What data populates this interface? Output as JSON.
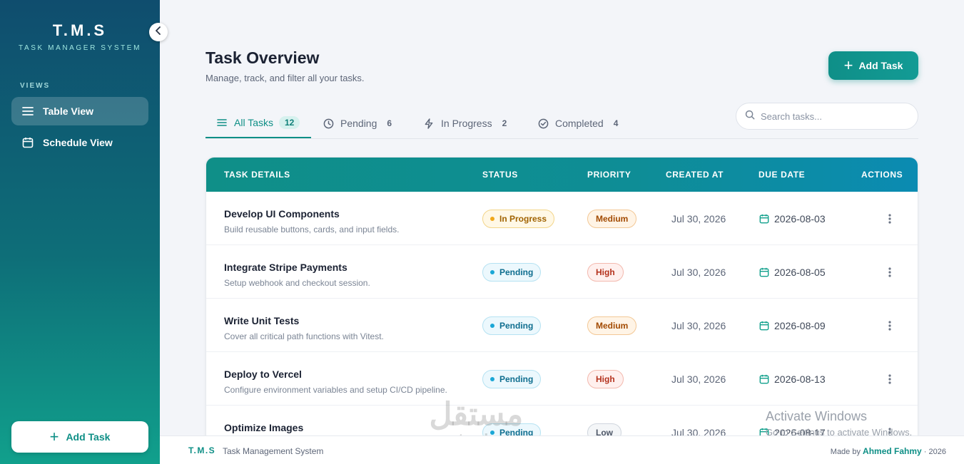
{
  "sidebar": {
    "title": "T.M.S",
    "subtitle": "TASK MANAGER SYSTEM",
    "section_label": "VIEWS",
    "items": [
      {
        "label": "Table View",
        "icon": "list-icon",
        "active": true
      },
      {
        "label": "Schedule View",
        "icon": "calendar-icon",
        "active": false
      }
    ],
    "add_label": "Add Task"
  },
  "header": {
    "title": "Task Overview",
    "subtitle": "Manage, track, and filter all your tasks.",
    "add_label": "Add Task"
  },
  "tabs": [
    {
      "label": "All Tasks",
      "count": "12",
      "icon": "list-icon"
    },
    {
      "label": "Pending",
      "count": "6",
      "icon": "clock-icon"
    },
    {
      "label": "In Progress",
      "count": "2",
      "icon": "bolt-icon"
    },
    {
      "label": "Completed",
      "count": "4",
      "icon": "check-circle-icon"
    }
  ],
  "search": {
    "placeholder": "Search tasks..."
  },
  "table": {
    "columns": [
      "TASK DETAILS",
      "STATUS",
      "PRIORITY",
      "CREATED AT",
      "DUE DATE",
      "ACTIONS"
    ],
    "rows": [
      {
        "name": "Develop UI Components",
        "desc": "Build reusable buttons, cards, and input fields.",
        "status": "In Progress",
        "priority": "Medium",
        "created": "Jul 30, 2026",
        "due": "2026-08-03"
      },
      {
        "name": "Integrate Stripe Payments",
        "desc": "Setup webhook and checkout session.",
        "status": "Pending",
        "priority": "High",
        "created": "Jul 30, 2026",
        "due": "2026-08-05"
      },
      {
        "name": "Write Unit Tests",
        "desc": "Cover all critical path functions with Vitest.",
        "status": "Pending",
        "priority": "Medium",
        "created": "Jul 30, 2026",
        "due": "2026-08-09"
      },
      {
        "name": "Deploy to Vercel",
        "desc": "Configure environment variables and setup CI/CD pipeline.",
        "status": "Pending",
        "priority": "High",
        "created": "Jul 30, 2026",
        "due": "2026-08-13"
      },
      {
        "name": "Optimize Images",
        "desc": "",
        "status": "Pending",
        "priority": "Low",
        "created": "Jul 30, 2026",
        "due": "2026-08-17"
      }
    ]
  },
  "footer": {
    "brand": "T.M.S",
    "subtitle": "Task Management System",
    "made_by": "Made by",
    "author": "Ahmed Fahmy",
    "year": "· 2026"
  },
  "watermark": {
    "activate_title": "Activate Windows",
    "activate_sub": "Go to Settings to activate Windows.",
    "site_ar": "مستقل",
    "site": "mostaql.com"
  },
  "colors": {
    "accent": "#0e8f86",
    "sidebar_top": "#0f4d6e",
    "sidebar_bottom": "#11a08c"
  }
}
